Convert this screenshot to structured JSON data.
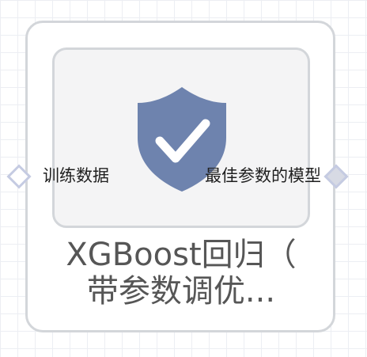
{
  "node": {
    "title_line1": "XGBoost回归（",
    "title_line2": "带参数调优..."
  },
  "ports": {
    "input_label": "训练数据",
    "output_label": "最佳参数的模型"
  },
  "icon": {
    "name": "shield-check-icon",
    "color": "#6e83ae",
    "check_color": "#ffffff"
  },
  "colors": {
    "card_border": "#d3d6da",
    "tile_background": "#f4f4f5",
    "port_border": "#c5cbe2",
    "title_text": "#565656"
  }
}
